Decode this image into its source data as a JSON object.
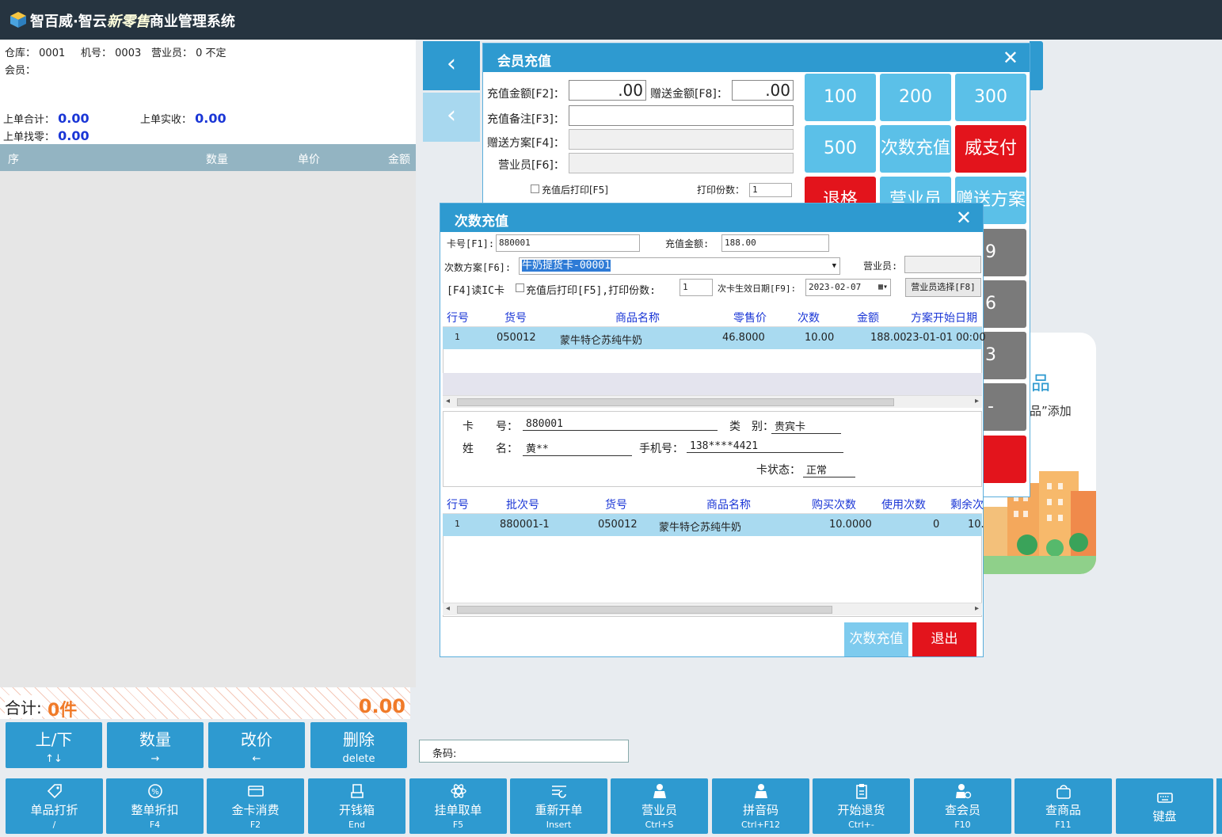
{
  "app": {
    "brand": "智百威",
    "title_mid": "·智云",
    "title_script": "新零售",
    "title_tail": "商业管理系统"
  },
  "pos_info": {
    "warehouse_label": "仓库：",
    "warehouse": "0001",
    "machine_label": "机号：",
    "machine": "0003",
    "clerk_label": "营业员：",
    "clerk": "0 不定",
    "member_label": "会员：",
    "last_total_label": "上单合计：",
    "last_total": "0.00",
    "last_paid_label": "上单实收：",
    "last_paid": "0.00",
    "last_change_label": "上单找零：",
    "last_change": "0.00"
  },
  "grid_columns": [
    "序",
    "数量",
    "单价",
    "金额"
  ],
  "total": {
    "label": "合计:",
    "count": "0件",
    "amount": "0.00"
  },
  "op_buttons": [
    {
      "label": "上/下",
      "key": "↑↓"
    },
    {
      "label": "数量",
      "key": "→"
    },
    {
      "label": "改价",
      "key": "←"
    },
    {
      "label": "删除",
      "key": "delete"
    }
  ],
  "nav": {
    "prev1": "‹",
    "prev2": "‹"
  },
  "illus_text": {
    "title": "品",
    "sub": "品”添加"
  },
  "recharge_dialog": {
    "title": "会员充值",
    "amount_label": "充值金额[F2]：",
    "amount_value": ".00",
    "gift_label": "赠送金额[F8]：",
    "gift_value": ".00",
    "remark_label": "充值备注[F3]：",
    "plan_label": "赠送方案[F4]：",
    "clerk_label": "营业员[F6]：",
    "print_after_label": "充值后打印[F5]",
    "copies_label": "打印份数：",
    "copies_value": "1",
    "keys": [
      "100",
      "200",
      "300",
      "500",
      "次数充值",
      "威支付",
      "退格",
      "营业员",
      "赠送方案",
      "9",
      "6",
      "3",
      "-"
    ]
  },
  "times_dialog": {
    "title": "次数充值",
    "card_label": "卡号[F1]:",
    "card_value": "880001",
    "amount_label": "充值金额:",
    "amount_value": "188.00",
    "plan_label": "次数方案[F6]:",
    "plan_value": "牛奶提货卡-00001",
    "clerk_label": "营业员:",
    "ic_label": "[F4]读IC卡",
    "print_after_label": "充值后打印[F5],打印份数:",
    "copies_value": "1",
    "effective_label": "次卡生效日期[F9]:",
    "effective_value": "2023-02-07",
    "clerk_select_label": "营业员选择[F8]",
    "plan_table": {
      "columns": [
        "行号",
        "货号",
        "商品名称",
        "零售价",
        "次数",
        "金额",
        "方案开始日期"
      ],
      "rows": [
        [
          "1",
          "050012",
          "蒙牛特仑苏纯牛奶",
          "46.8000",
          "10.00",
          "188.00",
          "23-01-01 00:00"
        ]
      ]
    },
    "card_info": {
      "card_no_label": "卡　　号：",
      "card_no": "880001",
      "type_label": "类　别：",
      "type": "贵宾卡",
      "name_label": "姓　　名：",
      "name": "黄**",
      "phone_label": "手机号：",
      "phone": "138****4421",
      "status_label": "卡状态：",
      "status": "正常"
    },
    "history_table": {
      "columns": [
        "行号",
        "批次号",
        "货号",
        "商品名称",
        "购买次数",
        "使用次数",
        "剩余次"
      ],
      "rows": [
        [
          "1",
          "880001-1",
          "050012",
          "蒙牛特仑苏纯牛奶",
          "10.0000",
          "0",
          "10."
        ]
      ]
    },
    "confirm_label": "次数充值",
    "exit_label": "退出"
  },
  "barcode": {
    "label": "条码:"
  },
  "func_buttons": [
    {
      "label": "单品打折",
      "key": "/",
      "icon": "tag-icon"
    },
    {
      "label": "整单折扣",
      "key": "F4",
      "icon": "percent-icon"
    },
    {
      "label": "金卡消费",
      "key": "F2",
      "icon": "card-icon"
    },
    {
      "label": "开钱箱",
      "key": "End",
      "icon": "cashbox-icon"
    },
    {
      "label": "挂单取单",
      "key": "F5",
      "icon": "atom-icon"
    },
    {
      "label": "重新开单",
      "key": "Insert",
      "icon": "list-icon"
    },
    {
      "label": "营业员",
      "key": "Ctrl+S",
      "icon": "person-icon"
    },
    {
      "label": "拼音码",
      "key": "Ctrl+F12",
      "icon": "person-icon"
    },
    {
      "label": "开始退货",
      "key": "Ctrl+-",
      "icon": "clipboard-icon"
    },
    {
      "label": "查会员",
      "key": "F10",
      "icon": "member-icon"
    },
    {
      "label": "查商品",
      "key": "F11",
      "icon": "bag-icon"
    },
    {
      "label": "键盘",
      "key": "",
      "icon": "keyboard-icon"
    }
  ],
  "colors": {
    "accent": "#2e9ad0",
    "light_accent": "#5bc0e8",
    "danger": "#e3141c",
    "value_blue": "#1a36d6",
    "total_orange": "#f07a28"
  }
}
